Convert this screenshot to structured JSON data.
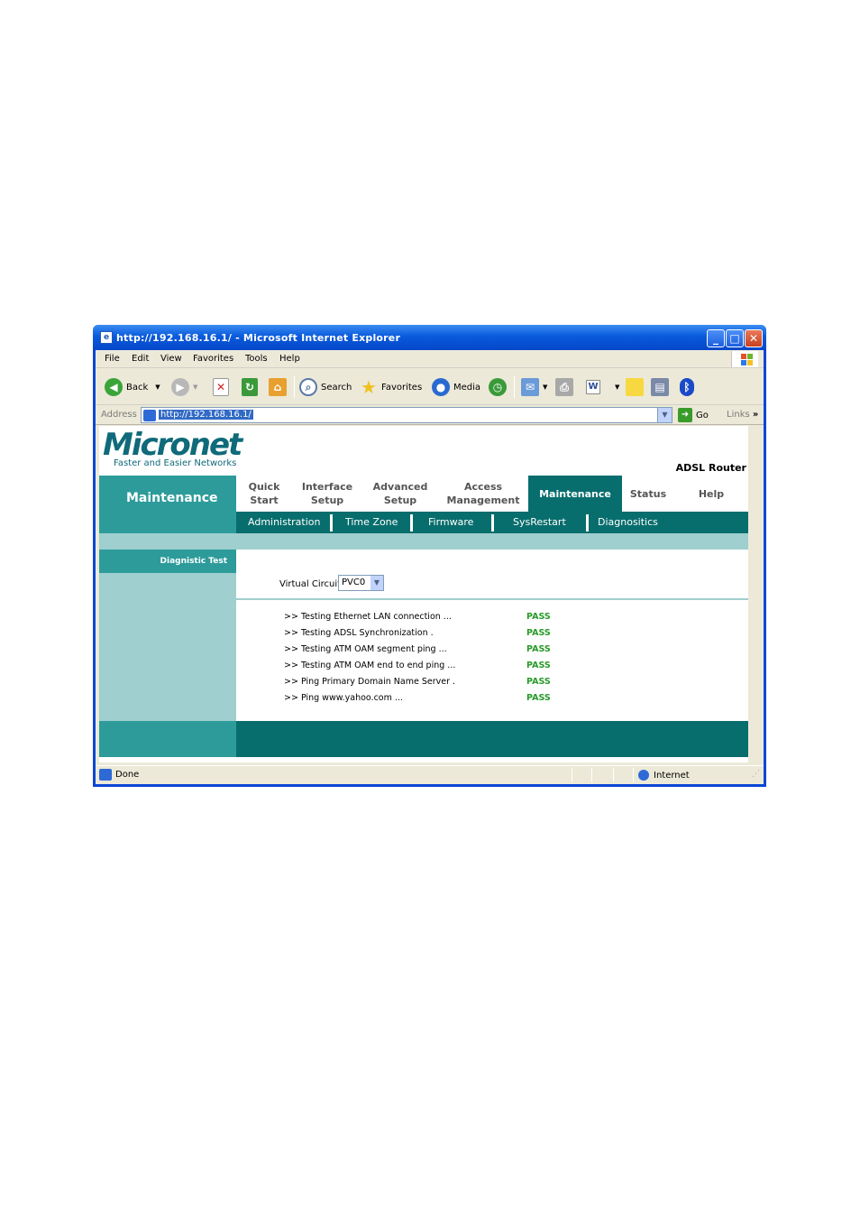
{
  "window": {
    "title": "http://192.168.16.1/ - Microsoft Internet Explorer",
    "minimize": "_",
    "maximize": "□",
    "close": "✕"
  },
  "menu": [
    "File",
    "Edit",
    "View",
    "Favorites",
    "Tools",
    "Help"
  ],
  "toolbar": {
    "back": "Back",
    "search": "Search",
    "favorites": "Favorites",
    "media": "Media"
  },
  "address": {
    "label": "Address",
    "url": "http://192.168.16.1/",
    "go": "Go",
    "links": "Links"
  },
  "page": {
    "brand": "Micronet",
    "tagline": "Faster and Easier Networks",
    "product": "ADSL Router",
    "section": "Maintenance",
    "tabs": [
      {
        "line1": "Quick",
        "line2": "Start"
      },
      {
        "line1": "Interface",
        "line2": "Setup"
      },
      {
        "line1": "Advanced",
        "line2": "Setup"
      },
      {
        "line1": "Access",
        "line2": "Management"
      },
      {
        "line1": "Maintenance",
        "line2": ""
      },
      {
        "line1": "Status",
        "line2": ""
      },
      {
        "line1": "Help",
        "line2": ""
      }
    ],
    "subtabs": [
      "Administration",
      "Time Zone",
      "Firmware",
      "SysRestart",
      "Diagnositics"
    ],
    "sidebar_title": "Diagnistic Test",
    "vc_label": "Virtual Circuit",
    "vc_value": "PVC0",
    "tests": [
      {
        "name": ">> Testing Ethernet LAN connection ...",
        "result": "PASS"
      },
      {
        "name": ">> Testing ADSL Synchronization .",
        "result": "PASS"
      },
      {
        "name": ">> Testing ATM OAM segment ping ...",
        "result": "PASS"
      },
      {
        "name": ">> Testing ATM OAM end to end ping ...",
        "result": "PASS"
      },
      {
        "name": ">> Ping Primary Domain Name Server .",
        "result": "PASS"
      },
      {
        "name": ">> Ping www.yahoo.com ...",
        "result": "PASS"
      }
    ]
  },
  "status": {
    "text": "Done",
    "zone": "Internet"
  }
}
